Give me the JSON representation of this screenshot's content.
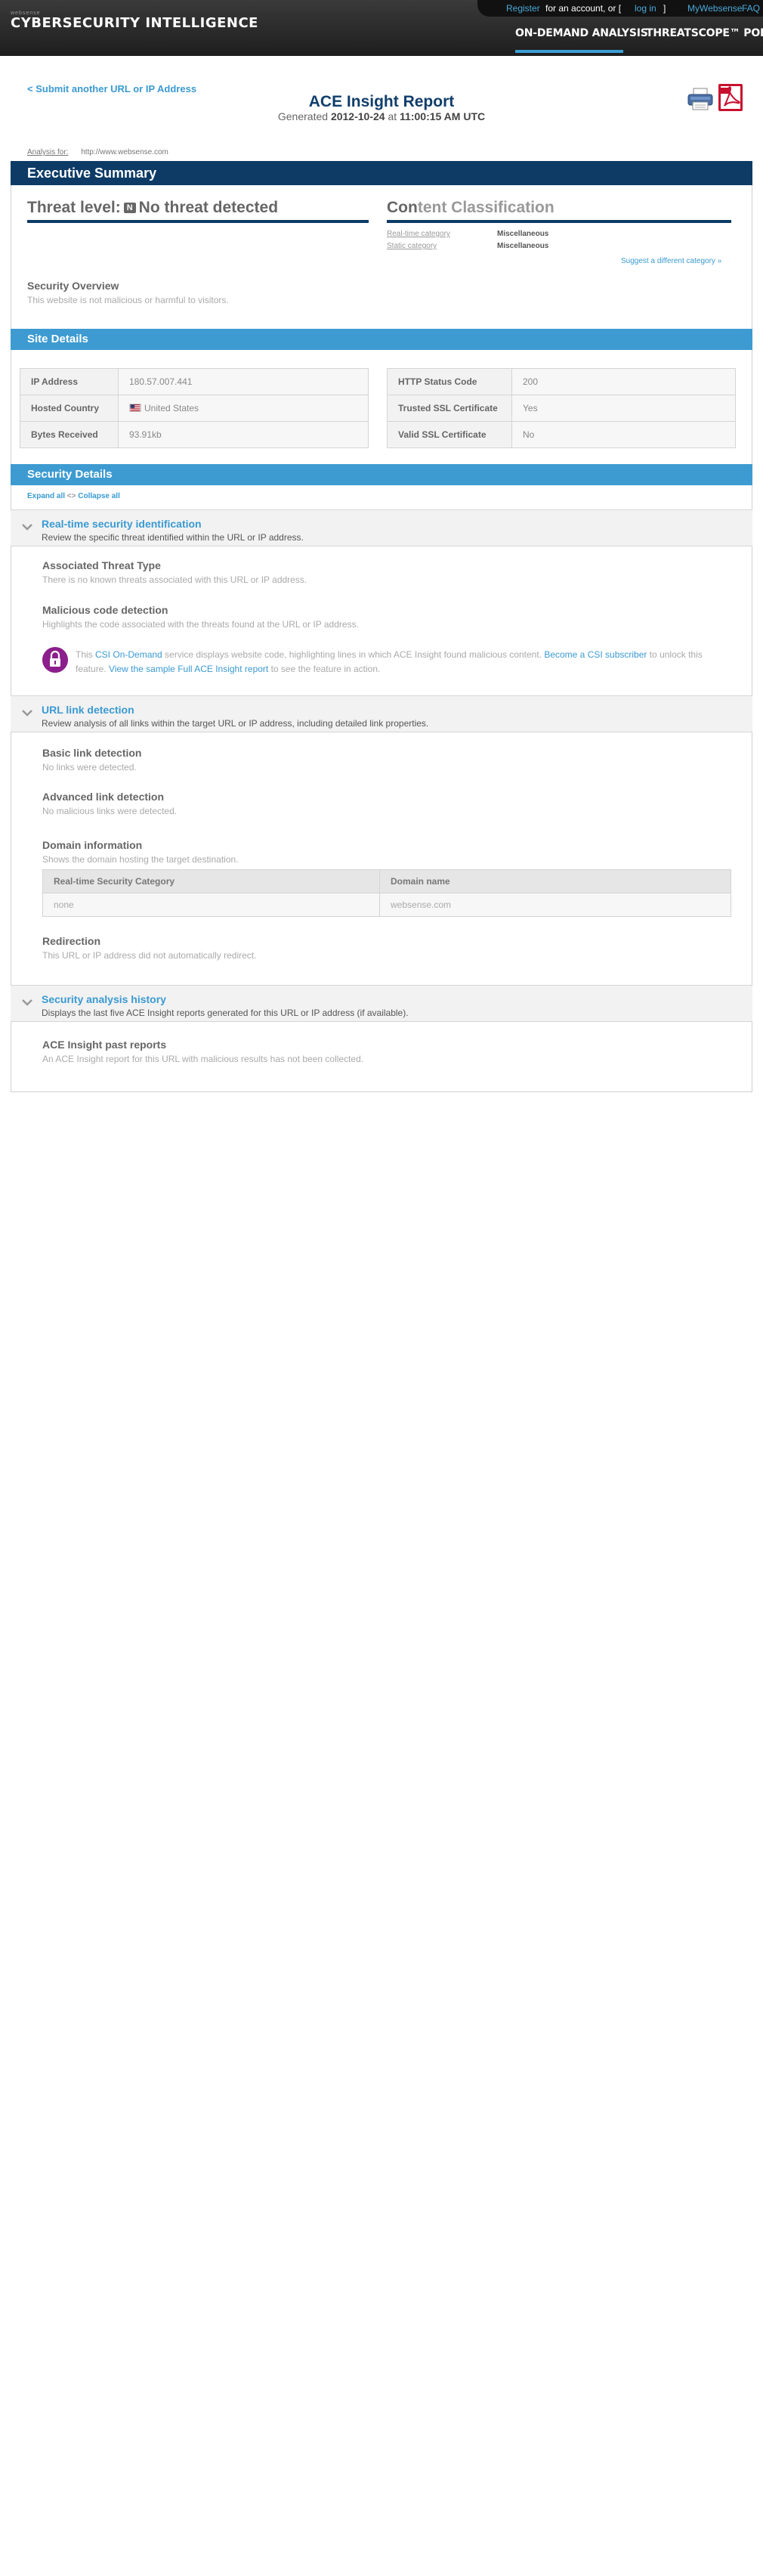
{
  "header": {
    "brand_small": "websense",
    "brand": "CYBERSECURITY INTELLIGENCE",
    "register": "Register",
    "for_account": "for an account, or [",
    "login": "log in",
    "bracket_close": "]",
    "mywebsense": "MyWebsense",
    "faq": "FAQ",
    "nav": [
      "ON-DEMAND ANALYSIS",
      "THREATSCOPE™ PORTAL"
    ]
  },
  "report": {
    "back_link": "< Submit another URL or IP Address",
    "title": "ACE Insight Report",
    "generated_prefix": "Generated",
    "generated_date": "2012-10-24",
    "generated_at": "at",
    "generated_time": "11:00:15 AM UTC",
    "analysis_label": "Analysis for:",
    "analysis_url": "http://www.websense.com",
    "print_icon": "printer-icon",
    "pdf_icon": "pdf-icon"
  },
  "executive_summary": {
    "heading": "Executive Summary",
    "threat_label": "Threat level:",
    "threat_badge": "N",
    "threat_value": "No threat detected",
    "content_prefix": "Con",
    "content_rest": "tent Classification",
    "realtime_label": "Real-time category",
    "realtime_value": "Miscellaneous",
    "static_label": "Static category",
    "static_value": "Miscellaneous",
    "suggest": "Suggest a different category »",
    "overview_heading": "Security Overview",
    "overview_text": "This website is not malicious or harmful to visitors."
  },
  "site_details": {
    "heading": "Site Details",
    "left": [
      {
        "key": "IP Address",
        "value": "180.57.007.441"
      },
      {
        "key": "Hosted Country",
        "value": "United States"
      },
      {
        "key": "Bytes Received",
        "value": "93.91kb"
      }
    ],
    "right": [
      {
        "key": "HTTP Status Code",
        "value": "200"
      },
      {
        "key": "Trusted SSL Certificate",
        "value": "Yes"
      },
      {
        "key": "Valid SSL Certificate",
        "value": "No"
      }
    ]
  },
  "security_details": {
    "heading": "Security Details",
    "expand_all": "Expand all",
    "separator": "<>",
    "collapse_all": "Collapse all",
    "realtime": {
      "title": "Real-time security identification",
      "subtitle": "Review the specific threat identified within the URL or IP address.",
      "threat_type_h": "Associated Threat Type",
      "threat_type_t": "There is no known threats associated with this URL or IP address.",
      "malicious_h": "Malicious code detection",
      "malicious_t": "Highlights the code associated with the threats found at the URL or IP address.",
      "csi_1": "This ",
      "csi_link": "CSI On-Demand",
      "csi_2": " service displays website code, highlighting lines in which ACE Insight found malicious content. ",
      "csi_sub": "Become a CSI subscriber",
      "csi_3": " to unlock this feature. ",
      "csi_sample": "View the sample Full ACE Insight report",
      "csi_4": " to see the feature in action."
    },
    "url_link": {
      "title": "URL link detection",
      "subtitle": "Review analysis of all links within the target URL or IP address, including detailed link properties.",
      "basic_h": "Basic link detection",
      "basic_t": "No links were detected.",
      "advanced_h": "Advanced link detection",
      "advanced_t": "No malicious links were detected.",
      "domain_h": "Domain information",
      "domain_t": "Shows the domain hosting the target destination.",
      "domain_cols": [
        "Real-time Security Category",
        "Domain name"
      ],
      "domain_row": [
        "none",
        "websense.com"
      ],
      "redirect_h": "Redirection",
      "redirect_t": "This URL or IP address did not automatically redirect."
    },
    "history": {
      "title": "Security analysis history",
      "subtitle": "Displays the last five ACE Insight reports generated for this URL or IP address (if available).",
      "past_h": "ACE Insight past reports",
      "past_t": "An ACE Insight report for this URL with malicious results has not been collected."
    }
  }
}
